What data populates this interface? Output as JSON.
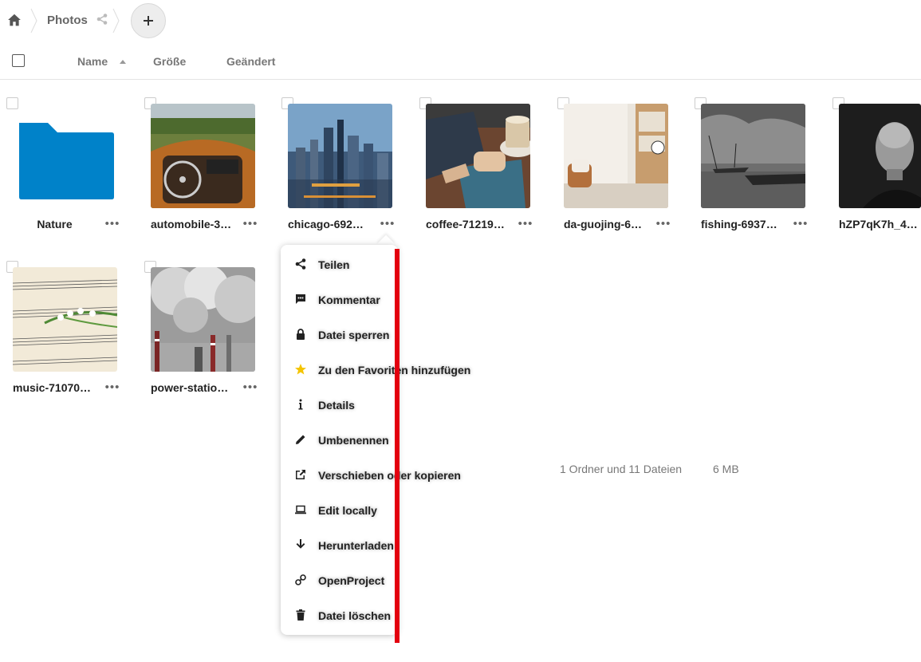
{
  "breadcrumb": {
    "home_icon": "home-icon",
    "folder": "Photos",
    "share_icon": "share-icon",
    "add_icon": "plus-icon"
  },
  "header": {
    "name": "Name",
    "size": "Größe",
    "modified": "Geändert"
  },
  "files": [
    {
      "name": "Nature",
      "type": "folder"
    },
    {
      "name": "automobile-3…",
      "type": "image"
    },
    {
      "name": "chicago-692…",
      "type": "image"
    },
    {
      "name": "coffee-71219…",
      "type": "image"
    },
    {
      "name": "da-guojing-6…",
      "type": "image"
    },
    {
      "name": "fishing-6937…",
      "type": "image"
    },
    {
      "name": "hZP7qK7h_4…",
      "type": "image"
    },
    {
      "name": "music-71070…",
      "type": "image"
    },
    {
      "name": "power-statio…",
      "type": "image"
    }
  ],
  "more_label": "•••",
  "context_menu": {
    "items": [
      {
        "label": "Teilen",
        "icon": "share-icon"
      },
      {
        "label": "Kommentar",
        "icon": "comment-icon"
      },
      {
        "label": "Datei sperren",
        "icon": "lock-icon"
      },
      {
        "label": "Zu den Favoriten hinzufügen",
        "icon": "star-icon"
      },
      {
        "label": "Details",
        "icon": "info-icon"
      },
      {
        "label": "Umbenennen",
        "icon": "pencil-icon"
      },
      {
        "label": "Verschieben oder kopieren",
        "icon": "external-link-icon"
      },
      {
        "label": "Edit locally",
        "icon": "laptop-icon"
      },
      {
        "label": "Herunterladen",
        "icon": "download-icon"
      },
      {
        "label": "OpenProject",
        "icon": "openproject-icon"
      },
      {
        "label": "Datei löschen",
        "icon": "trash-icon"
      }
    ]
  },
  "summary": {
    "counts": "1 Ordner und 11 Dateien",
    "size": "6 MB"
  },
  "colors": {
    "folder": "#0082c9",
    "star": "#f4c400",
    "annotation": "#e3000f"
  }
}
